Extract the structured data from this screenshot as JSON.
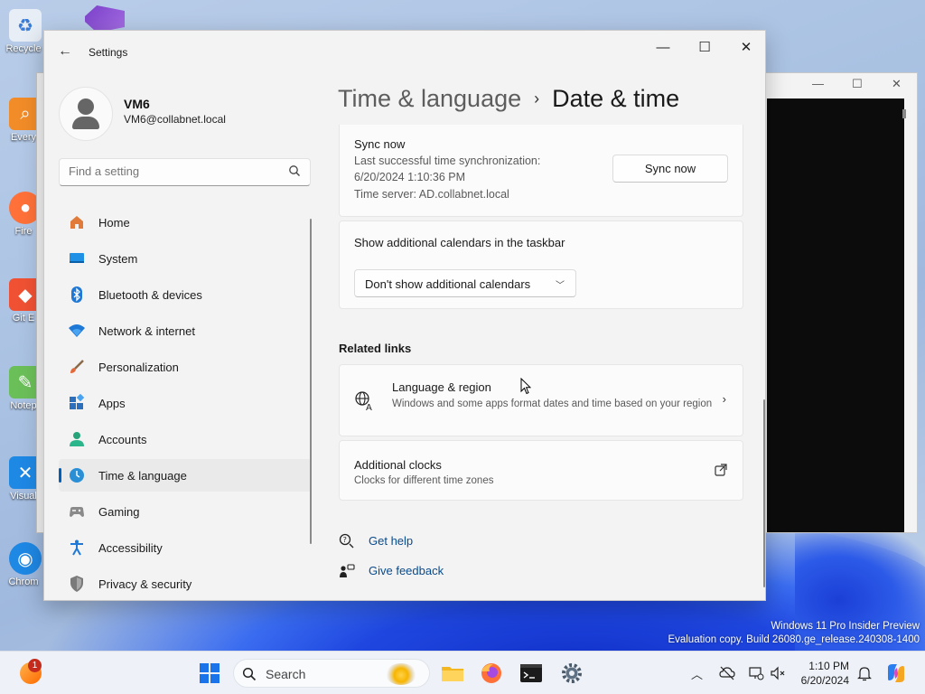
{
  "desktop": {
    "icons": [
      {
        "label": "Recycle"
      },
      {
        "label": "Every"
      },
      {
        "label": "Fire"
      },
      {
        "label": "Git E"
      },
      {
        "label": "Notep"
      },
      {
        "label": "Visual"
      },
      {
        "label": "Chrom"
      }
    ],
    "watermark": {
      "line1": "Windows 11 Pro Insider Preview",
      "line2": "Evaluation copy. Build 26080.ge_release.240308-1400"
    }
  },
  "settings": {
    "app_title": "Settings",
    "user": {
      "name": "VM6",
      "email": "VM6@collabnet.local"
    },
    "search": {
      "placeholder": "Find a setting"
    },
    "nav": [
      {
        "label": "Home",
        "icon": "home-icon"
      },
      {
        "label": "System",
        "icon": "system-icon"
      },
      {
        "label": "Bluetooth & devices",
        "icon": "bluetooth-icon"
      },
      {
        "label": "Network & internet",
        "icon": "wifi-icon"
      },
      {
        "label": "Personalization",
        "icon": "brush-icon"
      },
      {
        "label": "Apps",
        "icon": "apps-icon"
      },
      {
        "label": "Accounts",
        "icon": "accounts-icon"
      },
      {
        "label": "Time & language",
        "icon": "time-language-icon",
        "active": true
      },
      {
        "label": "Gaming",
        "icon": "gaming-icon"
      },
      {
        "label": "Accessibility",
        "icon": "accessibility-icon"
      },
      {
        "label": "Privacy & security",
        "icon": "shield-icon"
      }
    ],
    "breadcrumb": {
      "parent": "Time & language",
      "separator": "›",
      "current": "Date & time"
    },
    "sync": {
      "title": "Sync now",
      "last_sync_label": "Last successful time synchronization:",
      "last_sync_value": "6/20/2024 1:10:36 PM",
      "time_server": "Time server: AD.collabnet.local",
      "button": "Sync now"
    },
    "calendars": {
      "title": "Show additional calendars in the taskbar",
      "selected": "Don't show additional calendars"
    },
    "related": {
      "title": "Related links",
      "language_region": {
        "title": "Language & region",
        "description": "Windows and some apps format dates and time based on your region"
      },
      "additional_clocks": {
        "title": "Additional clocks",
        "description": "Clocks for different time zones"
      }
    },
    "help": {
      "get_help": "Get help",
      "give_feedback": "Give feedback"
    }
  },
  "taskbar": {
    "widget_badge": "1",
    "search_label": "Search",
    "time": "1:10 PM",
    "date": "6/20/2024"
  },
  "colors": {
    "accent": "#005fb8",
    "link": "#0a4b8c"
  }
}
